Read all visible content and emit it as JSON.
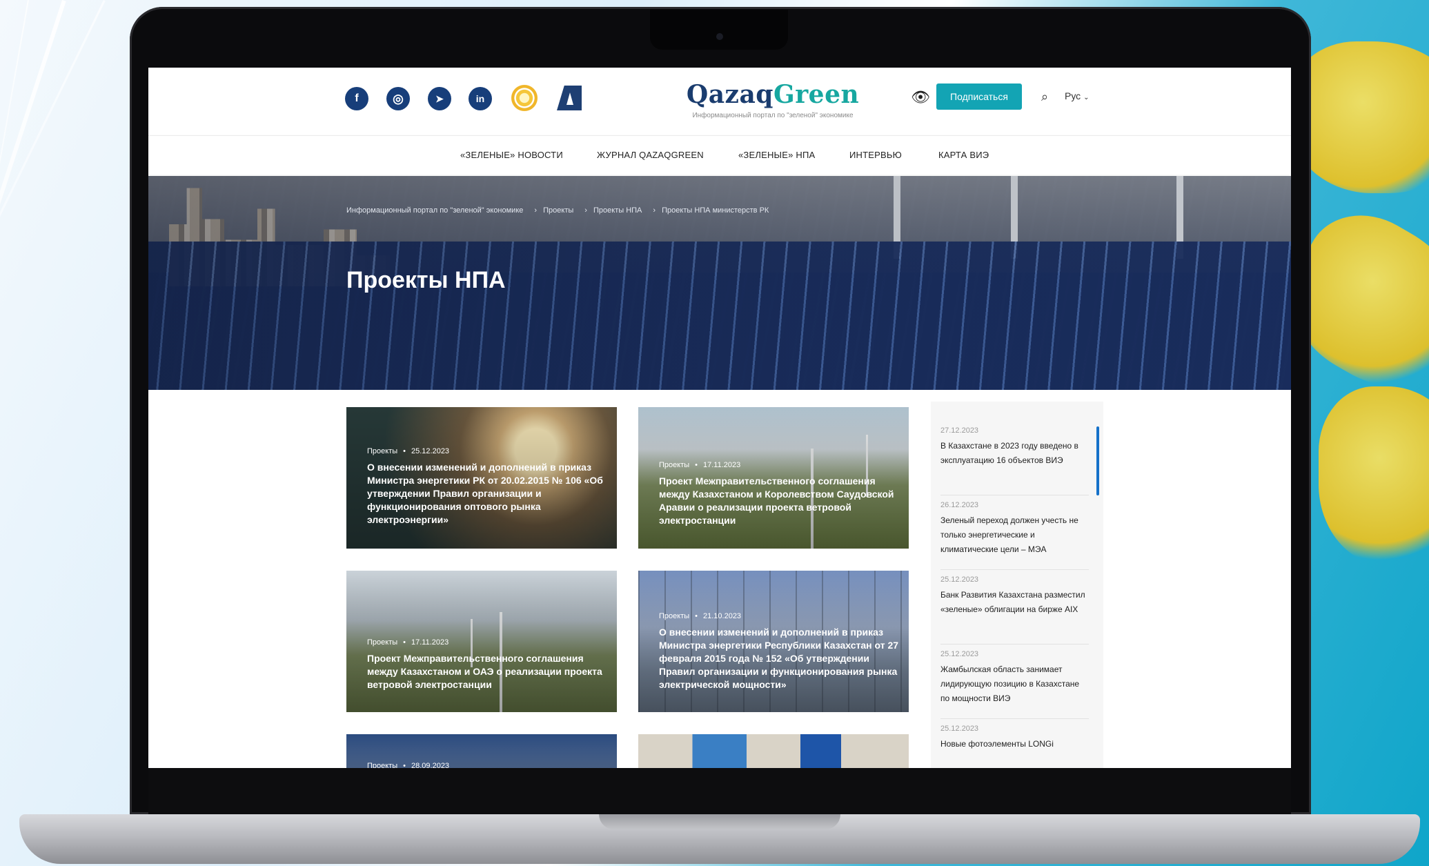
{
  "header": {
    "brand_part1": "Qazaq",
    "brand_part2": "Green",
    "tagline": "Информационный портал по \"зеленой\" экономике",
    "subscribe": "Подписаться",
    "language": "Рус",
    "social": [
      "facebook-icon",
      "instagram-icon",
      "telegram-icon",
      "linkedin-icon"
    ],
    "social_glyphs": [
      "f",
      "◎",
      "➤",
      "in"
    ]
  },
  "nav": [
    "«ЗЕЛЕНЫЕ» НОВОСТИ",
    "ЖУРНАЛ QAZAQGREEN",
    "«ЗЕЛЕНЫЕ» НПА",
    "ИНТЕРВЬЮ",
    "КАРТА ВИЭ"
  ],
  "hero": {
    "breadcrumbs": [
      "Информационный портал по \"зеленой\" экономике",
      "Проекты",
      "Проекты НПА",
      "Проекты НПА министерств РК"
    ],
    "title": "Проекты НПА"
  },
  "cards": [
    {
      "category": "Проекты",
      "date": "25.12.2023",
      "title": "О внесении изменений и дополнений в приказ Министра энергетики РК от 20.02.2015 № 106 «Об утверждении Правил организации и функционирования оптового рынка электроэнергии»"
    },
    {
      "category": "Проекты",
      "date": "17.11.2023",
      "title": "Проект Межправительственного соглашения между Казахстаном и Королевством Саудовской Аравии о реализации проекта ветровой электростанции"
    },
    {
      "category": "Проекты",
      "date": "17.11.2023",
      "title": "Проект Межправительственного соглашения между Казахстаном и ОАЭ о реализации проекта ветровой электростанции"
    },
    {
      "category": "Проекты",
      "date": "21.10.2023",
      "title": "О внесении изменений и дополнений в приказ Министра энергетики Республики Казахстан от 27 февраля 2015 года № 152 «Об утверждении Правил организации и функционирования рынка электрической мощности»"
    },
    {
      "category": "Проекты",
      "date": "28.09.2023",
      "title": ""
    }
  ],
  "sidebar": [
    {
      "date": "27.12.2023",
      "text": "В Казахстане в 2023 году введено в эксплуатацию 16 объектов ВИЭ"
    },
    {
      "date": "26.12.2023",
      "text": "Зеленый переход должен учесть не только энергетические и климатические цели – МЭА"
    },
    {
      "date": "25.12.2023",
      "text": "Банк Развития Казахстана разместил «зеленые» облигации на бирже AIX"
    },
    {
      "date": "25.12.2023",
      "text": "Жамбылская область занимает лидирующую позицию в Казахстане по мощности ВИЭ"
    },
    {
      "date": "25.12.2023",
      "text": "Новые фотоэлементы LONGi"
    }
  ],
  "colors": {
    "brand_blue": "#1a3c6e",
    "brand_green": "#17a7a0",
    "accent": "#13a4b4",
    "social": "#173e7a"
  }
}
